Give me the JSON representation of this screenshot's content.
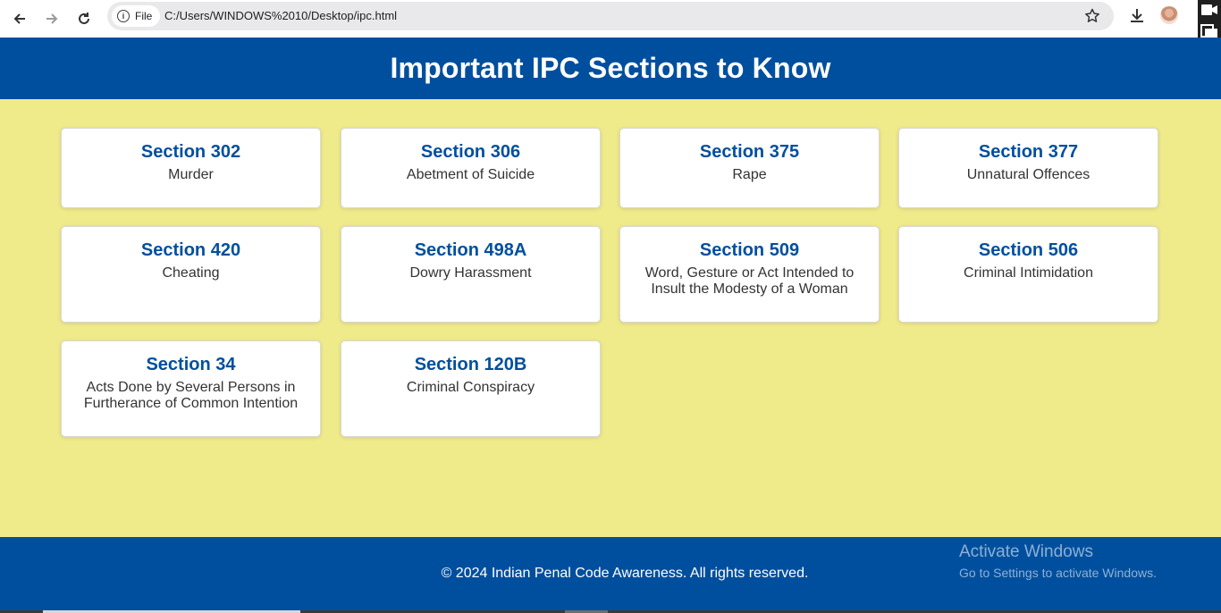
{
  "browser": {
    "site_chip_label": "File",
    "url": "C:/Users/WINDOWS%2010/Desktop/ipc.html"
  },
  "header": {
    "title": "Important IPC Sections to Know"
  },
  "sections": [
    {
      "title": "Section 302",
      "desc": "Murder"
    },
    {
      "title": "Section 306",
      "desc": "Abetment of Suicide"
    },
    {
      "title": "Section 375",
      "desc": "Rape"
    },
    {
      "title": "Section 377",
      "desc": "Unnatural Offences"
    },
    {
      "title": "Section 420",
      "desc": "Cheating"
    },
    {
      "title": "Section 498A",
      "desc": "Dowry Harassment"
    },
    {
      "title": "Section 509",
      "desc": "Word, Gesture or Act Intended to Insult the Modesty of a Woman"
    },
    {
      "title": "Section 506",
      "desc": "Criminal Intimidation"
    },
    {
      "title": "Section 34",
      "desc": "Acts Done by Several Persons in Furtherance of Common Intention"
    },
    {
      "title": "Section 120B",
      "desc": "Criminal Conspiracy"
    }
  ],
  "footer": {
    "text": "© 2024 Indian Penal Code Awareness. All rights reserved."
  },
  "watermark": {
    "title": "Activate Windows",
    "subtitle": "Go to Settings to activate Windows."
  },
  "colors": {
    "header_bg": "#004f9e",
    "page_bg": "#efea8a",
    "section_title": "#004f9e"
  }
}
